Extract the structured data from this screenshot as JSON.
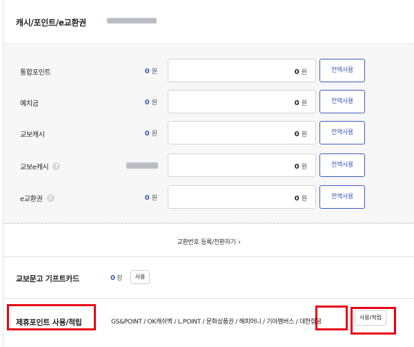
{
  "cash_section": {
    "title": "캐시/포인트/e교환권"
  },
  "rows": [
    {
      "label": "통합포인트",
      "balance": "0",
      "balance_unit": "원",
      "amount": "0",
      "amount_unit": "원",
      "button": "전액사용",
      "help": false,
      "balance_masked": false
    },
    {
      "label": "예치금",
      "balance": "0",
      "balance_unit": "원",
      "amount": "0",
      "amount_unit": "원",
      "button": "전액사용",
      "help": false,
      "balance_masked": false
    },
    {
      "label": "교보캐시",
      "balance": "0",
      "balance_unit": "원",
      "amount": "0",
      "amount_unit": "원",
      "button": "전액사용",
      "help": false,
      "balance_masked": false
    },
    {
      "label": "교보e캐시",
      "balance": "",
      "balance_unit": "",
      "amount": "0",
      "amount_unit": "원",
      "button": "전액사용",
      "help": true,
      "balance_masked": true
    },
    {
      "label": "e교환권",
      "balance": "0",
      "balance_unit": "원",
      "amount": "0",
      "amount_unit": "원",
      "button": "전액사용",
      "help": true,
      "balance_masked": false
    }
  ],
  "help_icon_glyph": "?",
  "exchange": {
    "link_label": "교환번호 등록/전환하기",
    "chevron": "›"
  },
  "gift_card": {
    "title": "교보문고 기프트카드",
    "count": "0",
    "count_unit": "장",
    "button": "사용"
  },
  "partner_points": {
    "title": "제휴포인트 사용/적립",
    "list": "GS&POINT / OK캐쉬백 / L.POINT / 문화상품권 / 해피머니 / 기아멤버스",
    "highlight": "대한항공",
    "button": "사용/적립"
  },
  "colors": {
    "accent": "#3d5ab8",
    "highlight_border": "#e60012",
    "panel_bg": "#f7f7f7"
  }
}
